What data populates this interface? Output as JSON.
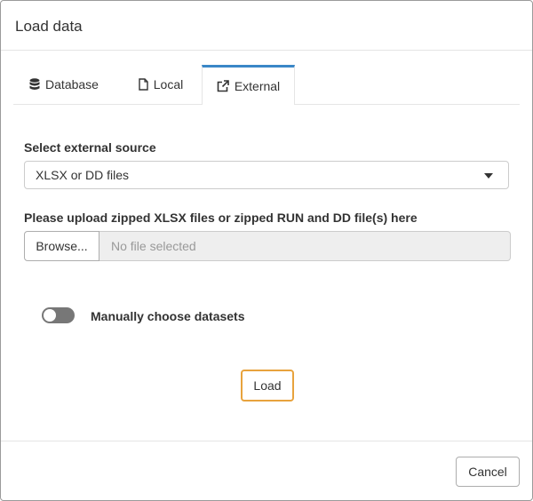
{
  "dialog": {
    "title": "Load data"
  },
  "tabs": [
    {
      "label": "Database",
      "icon": "database-icon",
      "active": false
    },
    {
      "label": "Local",
      "icon": "file-icon",
      "active": false
    },
    {
      "label": "External",
      "icon": "external-link-icon",
      "active": true
    }
  ],
  "external": {
    "source_label": "Select external source",
    "source_value": "XLSX or DD files",
    "upload_label": "Please upload zipped XLSX files or zipped RUN and DD file(s) here",
    "browse_label": "Browse...",
    "file_placeholder": "No file selected",
    "toggle_label": "Manually choose datasets",
    "toggle_on": false,
    "load_label": "Load"
  },
  "footer": {
    "cancel_label": "Cancel"
  },
  "colors": {
    "active_tab_accent": "#3a87c7",
    "load_button_border": "#e8a33d",
    "toggle_off": "#777777"
  }
}
